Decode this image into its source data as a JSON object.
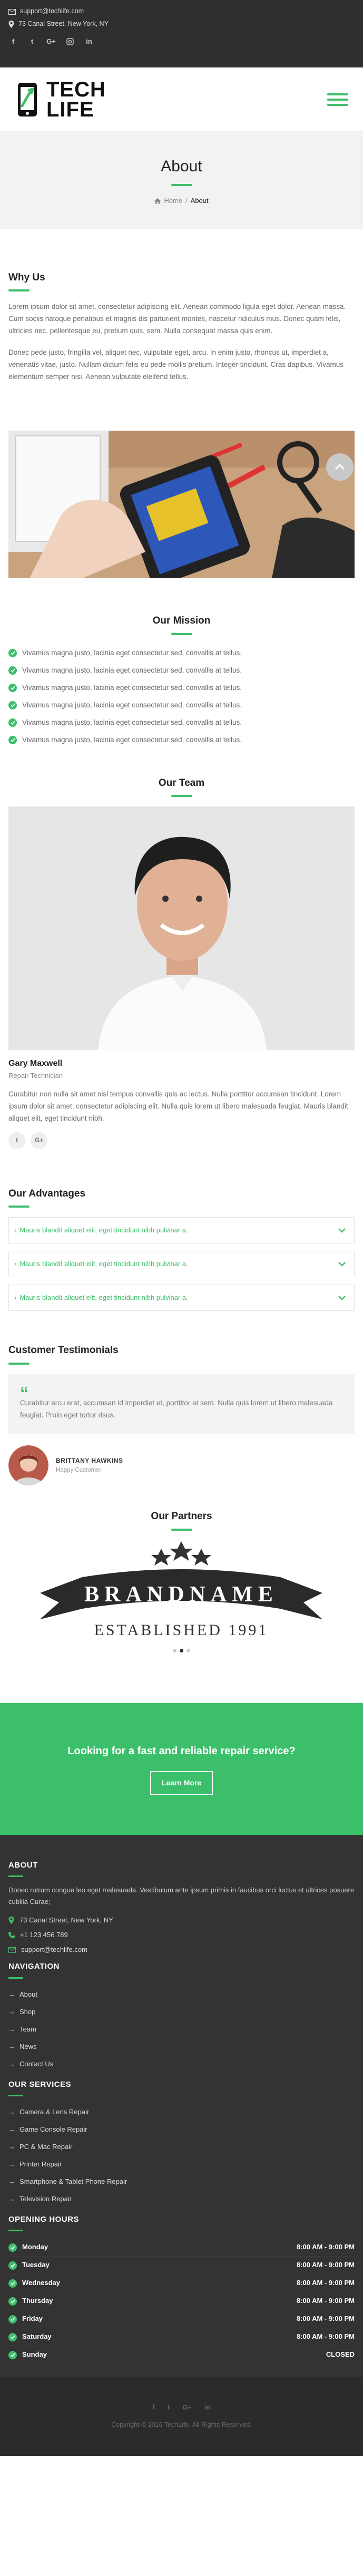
{
  "topbar": {
    "email": "support@techlife.com",
    "address": "73 Canal Street, New York, NY",
    "socials": [
      "f",
      "t",
      "G+",
      "ig",
      "in"
    ]
  },
  "header": {
    "logo_line1": "TECH",
    "logo_line2": "LIFE"
  },
  "page_title": {
    "title": "About",
    "crumb_home": "Home",
    "crumb_sep": "/",
    "crumb_current": "About"
  },
  "why_us": {
    "title": "Why Us",
    "p1": "Lorem ipsum dolor sit amet, consectetur adipiscing elit. Aenean commodo ligula eget dolor. Aenean massa. Cum sociis natoque penatibus et magnis dis parturient montes, nascetur ridiculus mus. Donec quam felis, ultricies nec, pellentesque eu, pretium quis, sem. Nulla consequat massa quis enim.",
    "p2": "Donec pede justo, fringilla vel, aliquet nec, vulputate eget, arcu. In enim justo, rhoncus ut, imperdiet a, venenatis vitae, justo. Nullam dictum felis eu pede mollis pretium. Integer tincidunt. Cras dapibus. Vivamus elementum semper nisi. Aenean vulputate eleifend tellus."
  },
  "mission": {
    "title": "Our Mission",
    "items": [
      "Vivamus magna justo, lacinia eget consectetur sed, convallis at tellus.",
      "Vivamus magna justo, lacinia eget consectetur sed, convallis at tellus.",
      "Vivamus magna justo, lacinia eget consectetur sed, convallis at tellus.",
      "Vivamus magna justo, lacinia eget consectetur sed, convallis at tellus.",
      "Vivamus magna justo, lacinia eget consectetur sed, convallis at tellus.",
      "Vivamus magna justo, lacinia eget consectetur sed, convallis at tellus."
    ]
  },
  "team": {
    "title": "Our Team",
    "name": "Gary Maxwell",
    "role": "Repair Technician",
    "bio": "Curabitur non nulla sit amet nisl tempus convallis quis ac lectus. Nulla porttitor accumsan tincidunt. Lorem ipsum dolor sit amet, consectetur adipiscing elit. Nulla quis lorem ut libero malesuada feugiat. Mauris blandit aliquet elit, eget tincidunt nibh.",
    "socials": [
      "t",
      "G+"
    ]
  },
  "advantages": {
    "title": "Our Advantages",
    "items": [
      "Mauris blandit aliquet elit, eget tincidunt nibh pulvinar a.",
      "Mauris blandit aliquet elit, eget tincidunt nibh pulvinar a.",
      "Mauris blandit aliquet elit, eget tincidunt nibh pulvinar a."
    ]
  },
  "testimonials": {
    "title": "Customer Testimonials",
    "quote": "Curabitur arcu erat, accumsan id imperdiet et, porttitor at sem. Nulla quis lorem ut libero malesuada feugiat. Proin eget tortor risus.",
    "author": "BRITTANY HAWKINS",
    "author_role": "Happy Customer"
  },
  "partners": {
    "title": "Our Partners",
    "brand_name": "BRANDNAME",
    "brand_tagline": "ESTABLISHED 1991"
  },
  "cta": {
    "title": "Looking for a fast and reliable repair service?",
    "button": "Learn More"
  },
  "footer": {
    "about_title": "ABOUT",
    "about_text": "Donec rutrum congue leo eget malesuada. Vestibulum ante ipsum primis in faucibus orci luctus et ultrices posuere cubilia Curae;",
    "address": "73 Canal Street, New York, NY",
    "phone": "+1 123 456 789",
    "email": "support@techlife.com",
    "nav_title": "NAVIGATION",
    "nav": [
      "About",
      "Shop",
      "Team",
      "News",
      "Contact Us"
    ],
    "services_title": "OUR SERVICES",
    "services": [
      "Camera & Lens Repair",
      "Game Console Repair",
      "PC & Mac Repair",
      "Printer Repair",
      "Smartphone & Tablet Phone Repair",
      "Television Repair"
    ],
    "hours_title": "OPENING HOURS",
    "hours": [
      {
        "day": "Monday",
        "time": "8:00 AM - 9:00 PM"
      },
      {
        "day": "Tuesday",
        "time": "8:00 AM - 9:00 PM"
      },
      {
        "day": "Wednesday",
        "time": "8:00 AM - 9:00 PM"
      },
      {
        "day": "Thursday",
        "time": "8:00 AM - 9:00 PM"
      },
      {
        "day": "Friday",
        "time": "8:00 AM - 9:00 PM"
      },
      {
        "day": "Saturday",
        "time": "8:00 AM - 9:00 PM"
      },
      {
        "day": "Sunday",
        "time": "CLOSED"
      }
    ],
    "socials": [
      "f",
      "t",
      "G+",
      "in"
    ],
    "copyright": "Copyright © 2016 TechLife. All Rights Reserved."
  },
  "colors": {
    "accent": "#3cbf6a",
    "dark": "#333333",
    "topbar": "#2f2f2f"
  }
}
